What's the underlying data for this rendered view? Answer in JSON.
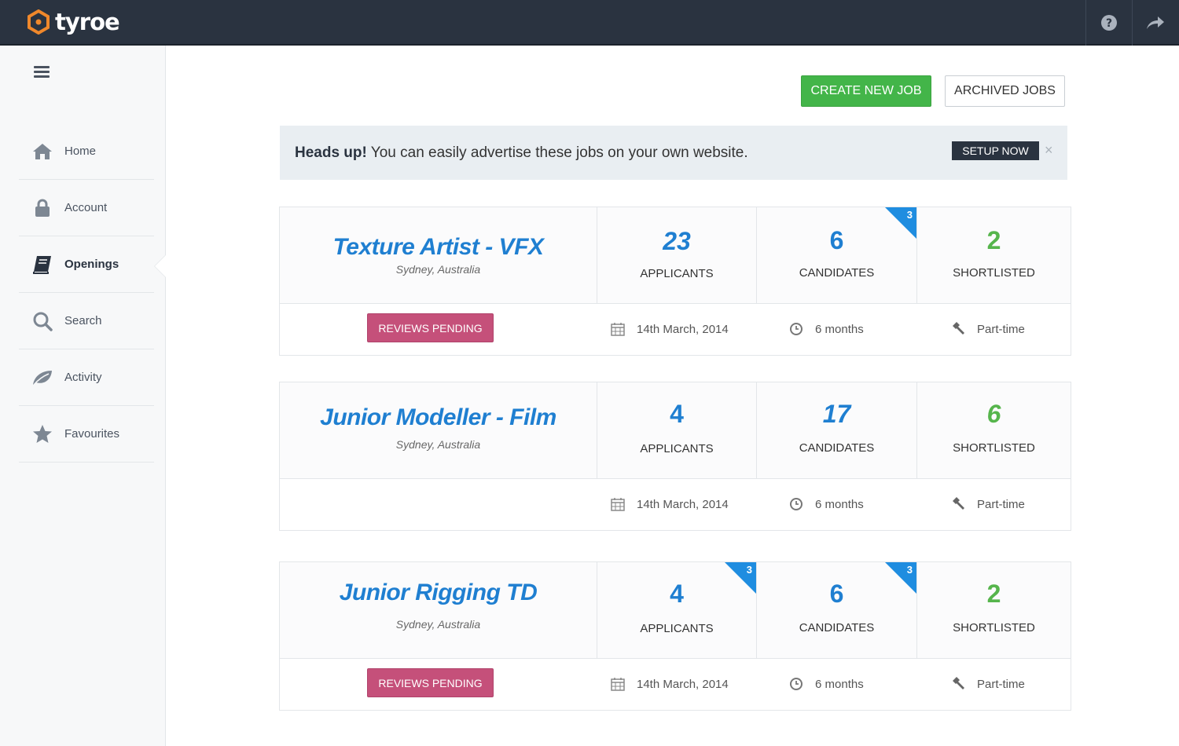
{
  "app": {
    "name": "tyroe"
  },
  "topbar": {
    "help_icon": "question-icon",
    "share_icon": "share-arrow-icon"
  },
  "sidebar": {
    "items": [
      {
        "label": "Home",
        "icon": "home-icon"
      },
      {
        "label": "Account",
        "icon": "lock-icon"
      },
      {
        "label": "Openings",
        "icon": "book-icon",
        "active": true
      },
      {
        "label": "Search",
        "icon": "search-icon"
      },
      {
        "label": "Activity",
        "icon": "leaf-icon"
      },
      {
        "label": "Favourites",
        "icon": "star-icon"
      }
    ]
  },
  "actions": {
    "create_label": "CREATE NEW JOB",
    "archived_label": "ARCHIVED JOBS"
  },
  "alert": {
    "bold": "Heads up!",
    "text": " You can easily advertise these jobs on your own website.",
    "button": "SETUP NOW",
    "close": "×"
  },
  "jobs": [
    {
      "title": "Texture Artist - VFX",
      "location": "Sydney, Australia",
      "applicants": "23",
      "applicants_label": "APPLICANTS",
      "candidates": "6",
      "candidates_label": "CANDIDATES",
      "candidates_new": "3",
      "shortlisted": "2",
      "shortlisted_label": "SHORTLISTED",
      "status": "REVIEWS PENDING",
      "date": "14th March, 2014",
      "duration": "6 months",
      "type": "Part-time"
    },
    {
      "title": "Junior Modeller - Film",
      "location": "Sydney, Australia",
      "applicants": "4",
      "applicants_label": "APPLICANTS",
      "candidates": "17",
      "candidates_label": "CANDIDATES",
      "shortlisted": "6",
      "shortlisted_label": "SHORTLISTED",
      "date": "14th March, 2014",
      "duration": "6 months",
      "type": "Part-time"
    },
    {
      "title": "Junior Rigging TD",
      "location": "Sydney, Australia",
      "applicants": "4",
      "applicants_label": "APPLICANTS",
      "applicants_new": "3",
      "candidates": "6",
      "candidates_label": "CANDIDATES",
      "candidates_new": "3",
      "shortlisted": "2",
      "shortlisted_label": "SHORTLISTED",
      "status": "REVIEWS PENDING",
      "date": "14th March, 2014",
      "duration": "6 months",
      "type": "Part-time"
    }
  ],
  "colors": {
    "accent": "#1f7fd1",
    "green": "#43b549",
    "pending": "#c5507a",
    "topbar": "#2a3340"
  }
}
